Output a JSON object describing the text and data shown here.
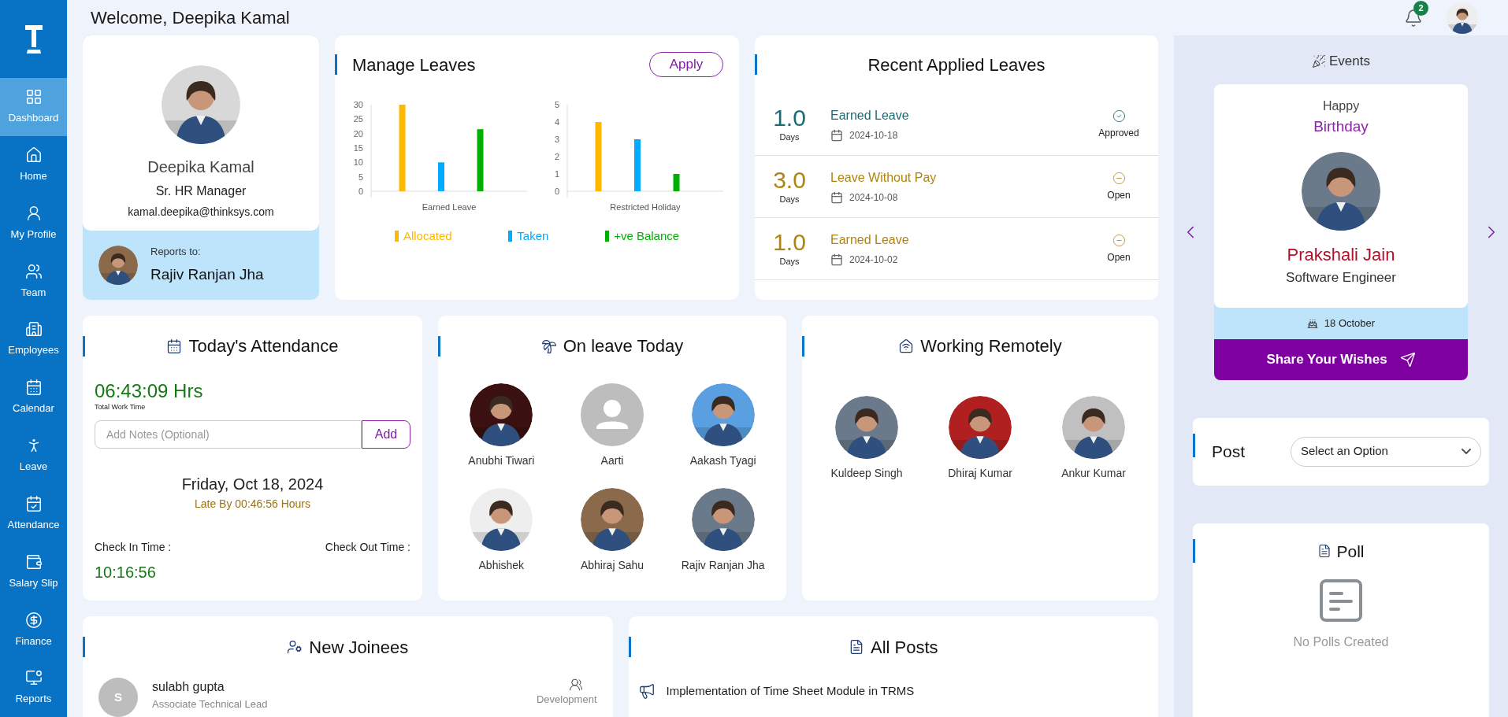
{
  "sidebar": {
    "items": [
      {
        "label": "Dashboard",
        "selected": true
      },
      {
        "label": "Home",
        "selected": false
      },
      {
        "label": "My Profile",
        "selected": false
      },
      {
        "label": "Team",
        "selected": false
      },
      {
        "label": "Employees",
        "selected": false
      },
      {
        "label": "Calendar",
        "selected": false
      },
      {
        "label": "Leave",
        "selected": false
      },
      {
        "label": "Attendance",
        "selected": false
      },
      {
        "label": "Salary Slip",
        "selected": false
      },
      {
        "label": "Finance",
        "selected": false
      },
      {
        "label": "Reports",
        "selected": false
      }
    ]
  },
  "header": {
    "title": "Welcome, Deepika Kamal",
    "notifications": "2"
  },
  "profile": {
    "name": "Deepika Kamal",
    "role": "Sr. HR Manager",
    "email": "kamal.deepika@thinksys.com",
    "reports_label": "Reports to:",
    "reports_name": "Rajiv Ranjan Jha"
  },
  "manage_leaves": {
    "title": "Manage Leaves",
    "apply": "Apply",
    "charts": [
      {
        "chart_data": {
          "type": "bar",
          "xlabel": "Earned Leave",
          "stacked": false,
          "ylim": [
            0,
            30
          ],
          "yticks": [
            0,
            5,
            10,
            15,
            20,
            25,
            30
          ],
          "series": [
            {
              "color": "#ffb800",
              "values": [
                30
              ]
            },
            {
              "color": "#00aaff",
              "values": [
                10
              ]
            },
            {
              "color": "#00b000",
              "values": [
                21.5
              ]
            }
          ]
        }
      },
      {
        "chart_data": {
          "type": "bar",
          "xlabel": "Restricted Holiday",
          "stacked": false,
          "ylim": [
            0,
            5
          ],
          "yticks": [
            0,
            1,
            2,
            3,
            4,
            5
          ],
          "series": [
            {
              "color": "#ffb800",
              "values": [
                4
              ]
            },
            {
              "color": "#00aaff",
              "values": [
                3
              ]
            },
            {
              "color": "#00b000",
              "values": [
                1
              ]
            }
          ]
        }
      }
    ],
    "legend": [
      {
        "label": "Allocated",
        "color": "#ffb800"
      },
      {
        "label": "Taken",
        "color": "#00aaff"
      },
      {
        "label": "+ve Balance",
        "color": "#00b000"
      }
    ]
  },
  "recent_leaves": {
    "title": "Recent Applied Leaves",
    "items": [
      {
        "days": "1.0",
        "unit": "Days",
        "type": "Earned Leave",
        "date": "2024-10-18",
        "status": "Approved",
        "kind": "approved"
      },
      {
        "days": "3.0",
        "unit": "Days",
        "type": "Leave Without Pay",
        "date": "2024-10-08",
        "status": "Open",
        "kind": "open"
      },
      {
        "days": "1.0",
        "unit": "Days",
        "type": "Earned Leave",
        "date": "2024-10-02",
        "status": "Open",
        "kind": "open"
      }
    ]
  },
  "attendance": {
    "title": "Today's Attendance",
    "work_time": "06:43:09 Hrs",
    "work_label": "Total Work Time",
    "notes_placeholder": "Add Notes (Optional)",
    "add": "Add",
    "date": "Friday, Oct 18, 2024",
    "late": "Late By 00:46:56 Hours",
    "check_in_label": "Check In Time :",
    "check_out_label": "Check Out Time :",
    "check_in": "10:16:56"
  },
  "on_leave": {
    "title": "On leave Today",
    "people": [
      {
        "name": "Anubhi Tiwari"
      },
      {
        "name": "Aarti",
        "kind": "default"
      },
      {
        "name": "Aakash Tyagi"
      },
      {
        "name": "Abhishek"
      },
      {
        "name": "Abhiraj Sahu"
      },
      {
        "name": "Rajiv Ranjan Jha"
      }
    ]
  },
  "remote": {
    "title": "Working Remotely",
    "people": [
      {
        "name": "Kuldeep Singh"
      },
      {
        "name": "Dhiraj Kumar"
      },
      {
        "name": "Ankur Kumar"
      }
    ]
  },
  "new_joinees": {
    "title": "New Joinees",
    "items": [
      {
        "initial": "S",
        "name": "sulabh gupta",
        "role": "Associate Technical Lead",
        "department": "Development"
      }
    ]
  },
  "all_posts": {
    "title": "All Posts",
    "items": [
      "Implementation of Time Sheet Module in TRMS"
    ]
  },
  "events": {
    "title": "Events",
    "greeting": "Happy",
    "occasion": "Birthday",
    "name": "Prakshali Jain",
    "role": "Software Engineer",
    "date": "18 October",
    "action": "Share Your Wishes"
  },
  "post": {
    "label": "Post",
    "select": "Select an Option"
  },
  "poll": {
    "title": "Poll",
    "empty": "No Polls Created"
  }
}
